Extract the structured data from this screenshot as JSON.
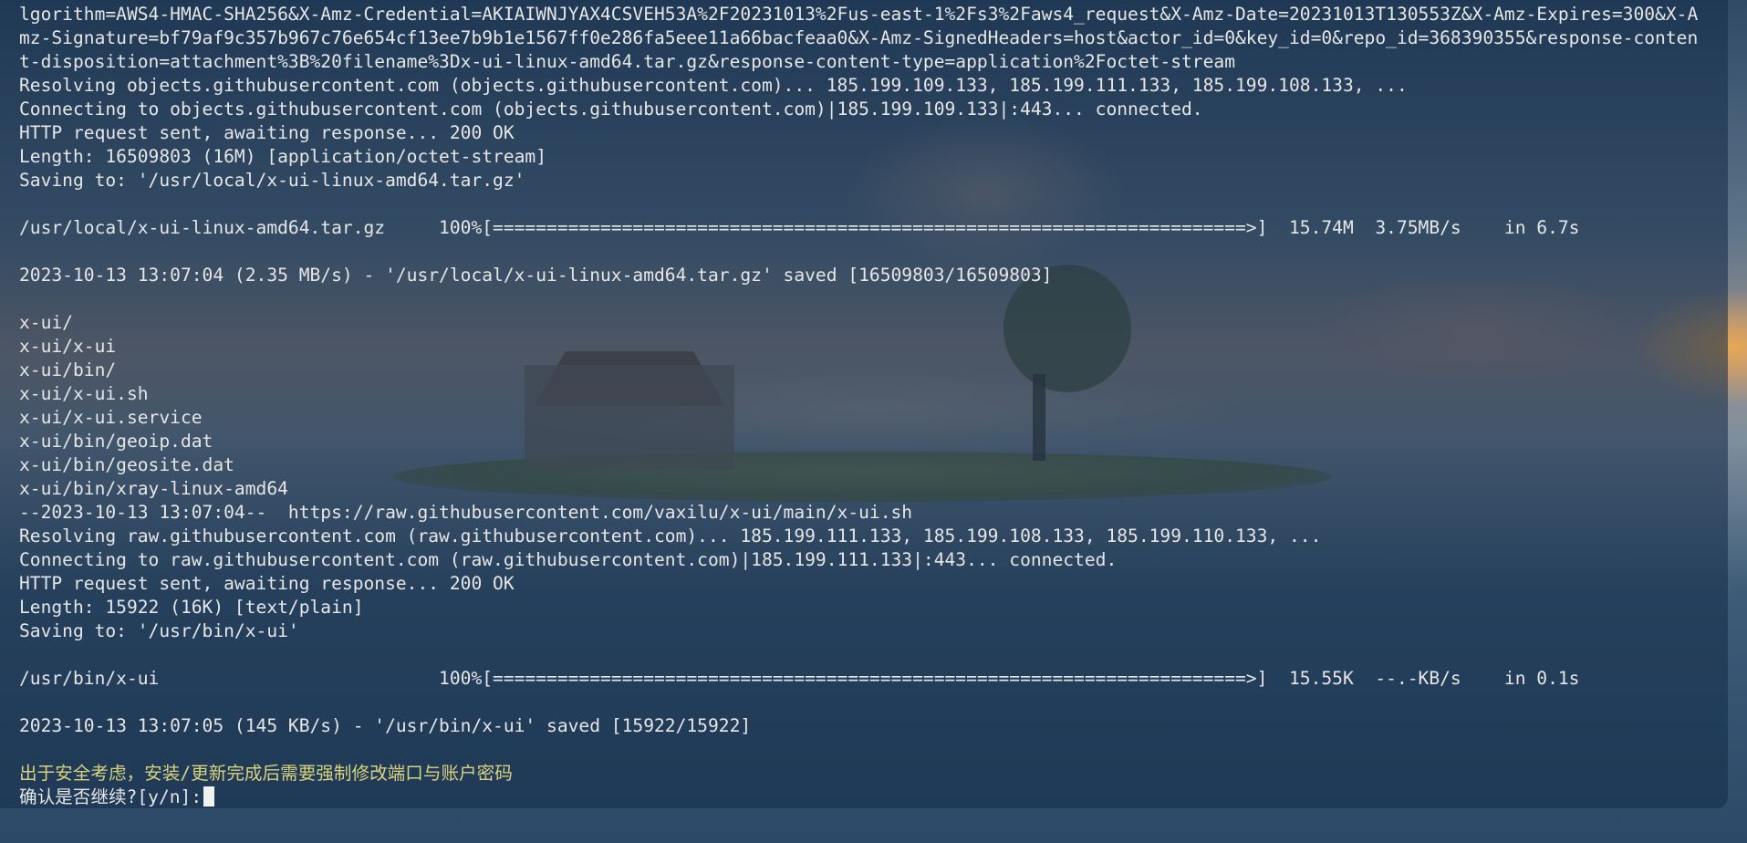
{
  "terminal": {
    "lines": [
      "lgorithm=AWS4-HMAC-SHA256&X-Amz-Credential=AKIAIWNJYAX4CSVEH53A%2F20231013%2Fus-east-1%2Fs3%2Faws4_request&X-Amz-Date=20231013T130553Z&X-Amz-Expires=300&X-A",
      "mz-Signature=bf79af9c357b967c76e654cf13ee7b9b1e1567ff0e286fa5eee11a66bacfeaa0&X-Amz-SignedHeaders=host&actor_id=0&key_id=0&repo_id=368390355&response-conten",
      "t-disposition=attachment%3B%20filename%3Dx-ui-linux-amd64.tar.gz&response-content-type=application%2Foctet-stream",
      "Resolving objects.githubusercontent.com (objects.githubusercontent.com)... 185.199.109.133, 185.199.111.133, 185.199.108.133, ...",
      "Connecting to objects.githubusercontent.com (objects.githubusercontent.com)|185.199.109.133|:443... connected.",
      "HTTP request sent, awaiting response... 200 OK",
      "Length: 16509803 (16M) [application/octet-stream]",
      "Saving to: '/usr/local/x-ui-linux-amd64.tar.gz'",
      "",
      "/usr/local/x-ui-linux-amd64.tar.gz     100%[======================================================================>]  15.74M  3.75MB/s    in 6.7s",
      "",
      "2023-10-13 13:07:04 (2.35 MB/s) - '/usr/local/x-ui-linux-amd64.tar.gz' saved [16509803/16509803]",
      "",
      "x-ui/",
      "x-ui/x-ui",
      "x-ui/bin/",
      "x-ui/x-ui.sh",
      "x-ui/x-ui.service",
      "x-ui/bin/geoip.dat",
      "x-ui/bin/geosite.dat",
      "x-ui/bin/xray-linux-amd64",
      "--2023-10-13 13:07:04--  https://raw.githubusercontent.com/vaxilu/x-ui/main/x-ui.sh",
      "Resolving raw.githubusercontent.com (raw.githubusercontent.com)... 185.199.111.133, 185.199.108.133, 185.199.110.133, ...",
      "Connecting to raw.githubusercontent.com (raw.githubusercontent.com)|185.199.111.133|:443... connected.",
      "HTTP request sent, awaiting response... 200 OK",
      "Length: 15922 (16K) [text/plain]",
      "Saving to: '/usr/bin/x-ui'",
      "",
      "/usr/bin/x-ui                          100%[======================================================================>]  15.55K  --.-KB/s    in 0.1s",
      "",
      "2023-10-13 13:07:05 (145 KB/s) - '/usr/bin/x-ui' saved [15922/15922]",
      ""
    ],
    "warning_line": "出于安全考虑，安装/更新完成后需要强制修改端口与账户密码",
    "prompt_line": "确认是否继续?[y/n]:",
    "colors": {
      "text": "#e6e6e6",
      "warning": "#d9d27c",
      "cursor": "#f2f2f2"
    }
  }
}
